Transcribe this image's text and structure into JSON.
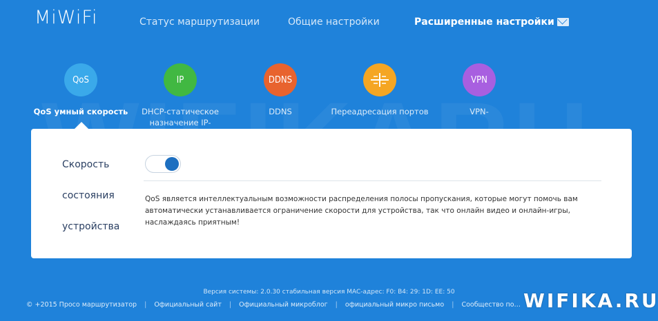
{
  "header": {
    "logo": "MiWiFi",
    "nav": [
      {
        "label": "Статус маршрутизации"
      },
      {
        "label": "Общие настройки"
      },
      {
        "label": "Расширенные настройки"
      }
    ]
  },
  "features": [
    {
      "icon_text": "QoS",
      "label": "QoS умный скорость",
      "color": "#3aa9ea"
    },
    {
      "icon_text": "IP",
      "label": "DHCP-статическое назначение IP-",
      "color": "#41b842"
    },
    {
      "icon_text": "DDNS",
      "label": "DDNS",
      "color": "#e8632e"
    },
    {
      "icon": "port-forward-icon",
      "label": "Переадресация портов",
      "color": "#f5a623"
    },
    {
      "icon_text": "VPN",
      "label": "VPN-",
      "color": "#a85fe0"
    }
  ],
  "panel": {
    "sidebar": [
      "Скорость",
      "состояния",
      "устройства"
    ],
    "toggle_on": true,
    "description": "QoS является интеллектуальным возможности распределения полосы пропускания, которые могут помочь вам автоматически устанавливается ограничение скорости для устройства, так что онлайн видео и онлайн-игры, наслаждаясь приятным!"
  },
  "footer": {
    "version": "Версия системы: 2.0.30 стабильная версия MAC-адрес: F0: B4: 29: 1D: EE: 50",
    "items": [
      "© +2015 Просо маршрутизатор",
      "Официальный сайт",
      "Официальный микроблог",
      "официальный микро письмо",
      "Сообщество по…"
    ],
    "watermark": "WIFIKA.RU"
  },
  "colors": {
    "background": "#1f82da",
    "toggle_knob": "#1d6fc0"
  }
}
